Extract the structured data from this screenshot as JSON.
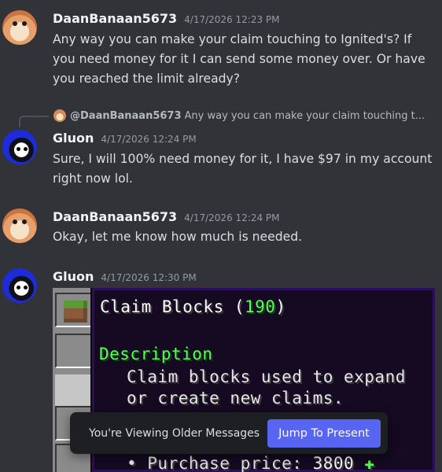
{
  "messages": [
    {
      "author": "DaanBanaan5673",
      "timestamp": "4/17/2026 12:23 PM",
      "content": "Any way you can make your claim touching to Ignited's? If you need money for it I can send some money over. Or have you reached the limit already?"
    },
    {
      "reply": {
        "author": "@DaanBanaan5673",
        "text": "Any way you can make your claim touching t..."
      },
      "author": "Gluon",
      "timestamp": "4/17/2026 12:24 PM",
      "content": "Sure, I will 100% need money for it, I have $97 in my account right now lol."
    },
    {
      "author": "DaanBanaan5673",
      "timestamp": "4/17/2026 12:24 PM",
      "content": "Okay, let me know how much is needed."
    },
    {
      "author": "Gluon",
      "timestamp": "4/17/2026 12:30 PM",
      "attachment": {
        "title_prefix": "Claim Blocks (",
        "title_count": "190",
        "title_suffix": ")",
        "description_heading": "Description",
        "description_line1": "Claim blocks used to expand",
        "description_line2": "or create new claims.",
        "price_label": "• Purchase price: ",
        "price_value": "3800",
        "price_suffix": " ✚"
      }
    }
  ],
  "toast": {
    "text": "You're Viewing Older Messages",
    "button": "Jump To Present"
  },
  "colors": {
    "background": "#313338",
    "accent": "#5865f2",
    "minecraft_green": "#55ff55"
  }
}
